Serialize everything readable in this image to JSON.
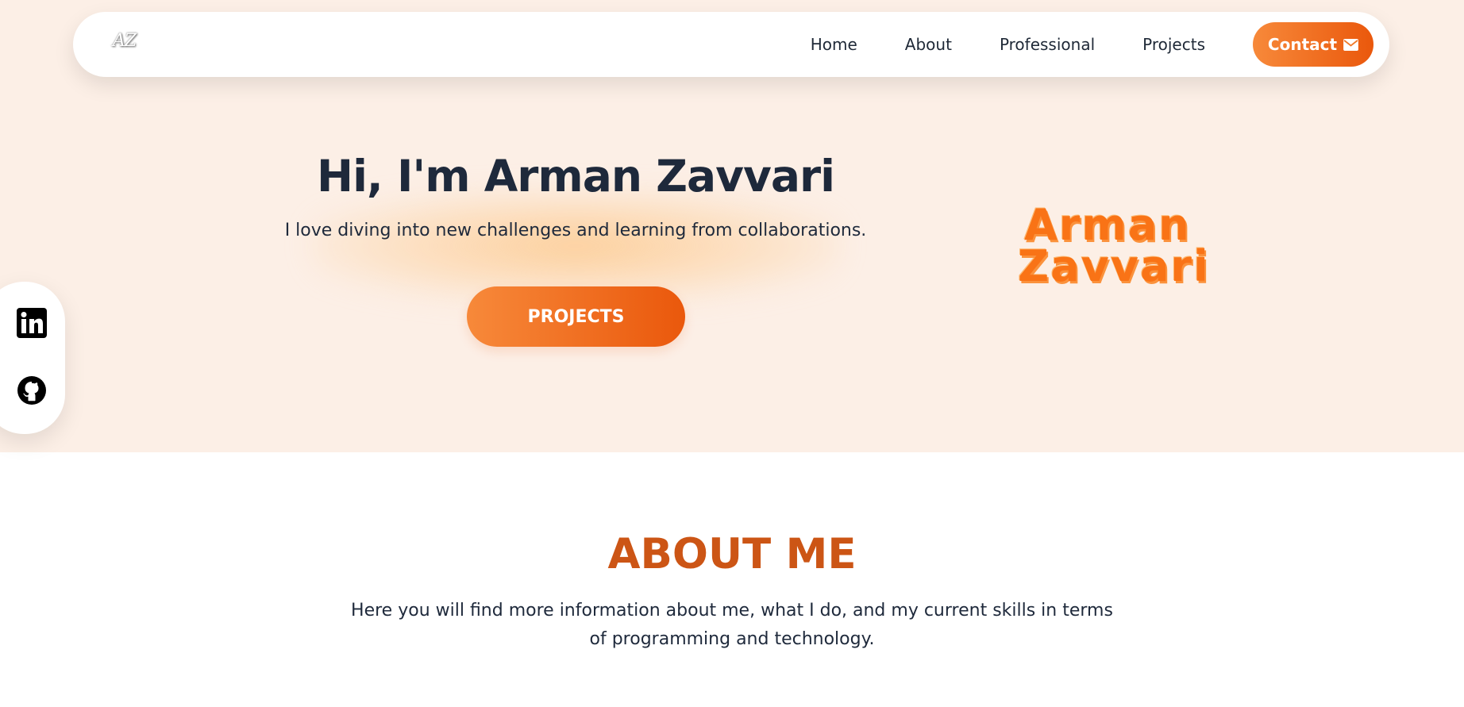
{
  "nav": {
    "logo": "AZ",
    "links": [
      "Home",
      "About",
      "Professional",
      "Projects"
    ],
    "contact_label": "Contact"
  },
  "hero": {
    "title": "Hi, I'm Arman Zavvari",
    "subtitle": "I love diving into new challenges and learning from collaborations.",
    "button_label": "PROJECTS",
    "signature_line1": "Arman",
    "signature_line2": "Zavvari"
  },
  "social": {
    "icons": [
      "linkedin-icon",
      "github-icon"
    ]
  },
  "about": {
    "title": "ABOUT ME",
    "text": "Here you will find more information about me, what I do, and my current skills in terms of programming and technology."
  },
  "colors": {
    "accent": "#f97316",
    "accent_dark": "#ea580c",
    "hero_bg": "#fcefe6",
    "about_title": "#cc5515",
    "text": "#1e293b"
  }
}
